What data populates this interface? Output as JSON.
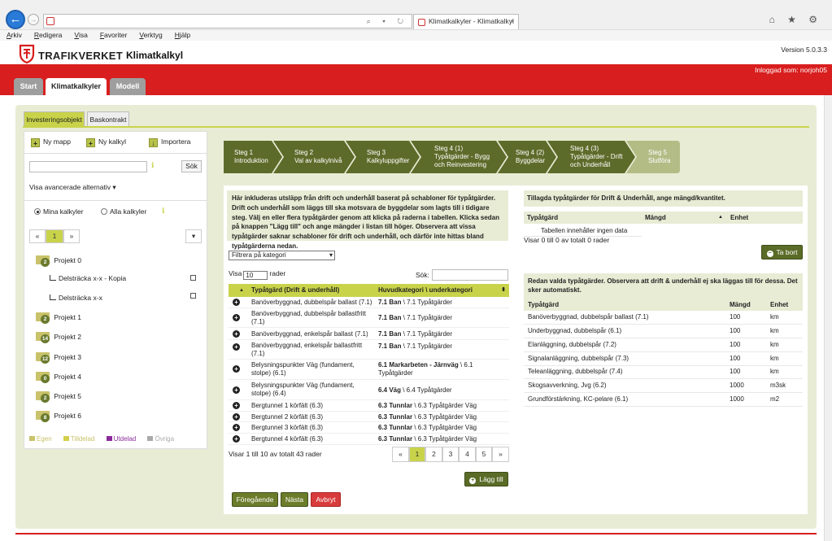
{
  "browser": {
    "tab_title": "Klimatkalkyler - Klimatkalkyl",
    "back_icon": "←",
    "forward_icon": "→",
    "address_controls": "⌕ ▾ ↻",
    "tab_close": "×",
    "icons": "⌂ ★ ⚙",
    "menu": [
      "Arkiv",
      "Redigera",
      "Visa",
      "Favoriter",
      "Verktyg",
      "Hjälp"
    ]
  },
  "header": {
    "brand": "TRAFIKVERKET",
    "app_name": "Klimatkalkyl",
    "version": "Version 5.0.3.3",
    "logged_in": "Inloggad som: norjoh05"
  },
  "nav": {
    "start": "Start",
    "klimatkalkyler": "Klimatkalkyler",
    "modell": "Modell"
  },
  "subtabs": {
    "investering": "Investeringsobjekt",
    "baskontrakt": "Baskontrakt"
  },
  "left": {
    "plus_icon": "+",
    "import_icon": "↓",
    "info_icon": "ℹ",
    "chevron_icon": "▾",
    "new_folder": "Ny mapp",
    "new_calc": "Ny kalkyl",
    "import": "Importera",
    "search_button": "Sök",
    "advanced": "Visa avancerade alternativ",
    "radio_mine": "Mina kalkyler",
    "radio_all": "Alla kalkyler",
    "pager": {
      "prev": "«",
      "page": "1",
      "next": "»",
      "dropdown": "▾"
    },
    "projects": [
      {
        "name": "Projekt 0",
        "count": "2"
      },
      {
        "name": "Projekt 1",
        "count": "2"
      },
      {
        "name": "Projekt 2",
        "count": "14"
      },
      {
        "name": "Projekt 3",
        "count": "12"
      },
      {
        "name": "Projekt 4",
        "count": "0"
      },
      {
        "name": "Projekt 5",
        "count": "2"
      },
      {
        "name": "Projekt 6",
        "count": "8"
      }
    ],
    "calcs": [
      "Delsträcka x-x - Kopia",
      "Delsträcka x-x"
    ],
    "legend": [
      {
        "label": "Egen",
        "color": "#c9c26a"
      },
      {
        "label": "Tilldelad",
        "color": "#d4cf4a"
      },
      {
        "label": "Utdelad",
        "color": "#8a2a9a"
      },
      {
        "label": "Övriga",
        "color": "#aaaaaa"
      }
    ]
  },
  "steps": [
    {
      "l1": "Steg 1",
      "l2": "Introduktion",
      "l3": "",
      "color": "#5d6b2a"
    },
    {
      "l1": "Steg 2",
      "l2": "Val av kalkylnivå",
      "l3": "",
      "color": "#5d6b2a"
    },
    {
      "l1": "Steg 3",
      "l2": "Kalkyluppgifter",
      "l3": "",
      "color": "#5d6b2a"
    },
    {
      "l1": "Steg 4 (1)",
      "l2": "Typåtgärder - Bygg",
      "l3": "och Reinvestering",
      "color": "#5d6b2a"
    },
    {
      "l1": "Steg 4 (2)",
      "l2": "Byggdelar",
      "l3": "",
      "color": "#5d6b2a"
    },
    {
      "l1": "Steg 4 (3)",
      "l2": "Typåtgärder - Drift",
      "l3": "och Underhåll",
      "color": "#5d6b2a"
    },
    {
      "l1": "Steg 5",
      "l2": "Slutföra",
      "l3": "",
      "color": "#b4bc86"
    }
  ],
  "intro": "Här inkluderas utsläpp från drift och underhåll baserat på schabloner för typåtgärder. Drift och underhåll som läggs till ska motsvara de byggdelar som lagts till i tidigare steg. Välj en eller flera typåtgärder genom att klicka på raderna i tabellen. Klicka sedan på knappen \"Lägg till\" och ange mängder i listan till höger. Observera att vissa typåtgärder saknar schabloner för drift och underhåll, och därför inte hittas bland typåtgärderna nedan.",
  "filter": {
    "value": "Filtrera på kategori"
  },
  "show": {
    "prefix": "Visa",
    "value": "10",
    "suffix": "rader",
    "search": "Sök:"
  },
  "table": {
    "headers": [
      "Typåtgärd (Drift & underhåll)",
      "Huvudkategori \\ underkategori"
    ],
    "sort_asc": "▲",
    "sort_both": "⬍",
    "add_icon": "+",
    "rows": [
      {
        "name": "Banöverbyggnad, dubbelspår ballast (7.1)",
        "cat": "7.1 Ban",
        "sub": " \\ 7.1 Typåtgärder"
      },
      {
        "name": "Banöverbyggnad, dubbelspår ballastfritt (7.1)",
        "cat": "7.1 Ban",
        "sub": " \\ 7.1 Typåtgärder"
      },
      {
        "name": "Banöverbyggnad, enkelspår ballast (7.1)",
        "cat": "7.1 Ban",
        "sub": " \\ 7.1 Typåtgärder"
      },
      {
        "name": "Banöverbyggnad, enkelspår ballastfritt (7.1)",
        "cat": "7.1 Ban",
        "sub": " \\ 7.1 Typåtgärder"
      },
      {
        "name": "Belysningspunkter Väg (fundament, stolpe) (6.1)",
        "cat": "6.1 Markarbeten - Järnväg",
        "sub": " \\ 6.1 Typåtgärder"
      },
      {
        "name": "Belysningspunkter Väg (fundament, stolpe) (6.4)",
        "cat": "6.4 Väg",
        "sub": " \\ 6.4 Typåtgärder"
      },
      {
        "name": "Bergtunnel 1 körfält (6.3)",
        "cat": "6.3 Tunnlar",
        "sub": " \\ 6.3 Typåtgärder Väg"
      },
      {
        "name": "Bergtunnel 2 körfält (6.3)",
        "cat": "6.3 Tunnlar",
        "sub": " \\ 6.3 Typåtgärder Väg"
      },
      {
        "name": "Bergtunnel 3 körfält (6.3)",
        "cat": "6.3 Tunnlar",
        "sub": " \\ 6.3 Typåtgärder Väg"
      },
      {
        "name": "Bergtunnel 4 körfält (6.3)",
        "cat": "6.3 Tunnlar",
        "sub": " \\ 6.3 Typåtgärder Väg"
      }
    ],
    "info": "Visar 1 till 10 av totalt 43 rader",
    "pager": [
      "«",
      "1",
      "2",
      "3",
      "4",
      "5",
      "»"
    ]
  },
  "buttons": {
    "add": "Lägg till",
    "remove": "Ta bort",
    "prev": "Föregående",
    "next": "Nästa",
    "cancel": "Avbryt",
    "add_icon": "+",
    "remove_icon": "−"
  },
  "added": {
    "title": "Tillagda typåtgärder för Drift & Underhåll, ange mängd/kvantitet.",
    "headers": [
      "Typåtgärd",
      "Mängd",
      "Enhet"
    ],
    "sort_asc": "▲",
    "empty": "Tabellen innehåller ingen data",
    "info": "Visar 0 till 0 av totalt 0 rader"
  },
  "selected": {
    "title": "Redan valda typåtgärder. Observera att drift & underhåll ej ska läggas till för dessa. Det sker automatiskt.",
    "headers": [
      "Typåtgärd",
      "Mängd",
      "Enhet"
    ],
    "rows": [
      [
        "Banöverbyggnad, dubbelspår ballast (7.1)",
        "100",
        "km"
      ],
      [
        "Underbyggnad, dubbelspår (6.1)",
        "100",
        "km"
      ],
      [
        "Elanläggning, dubbelspår (7.2)",
        "100",
        "km"
      ],
      [
        "Signalanläggning, dubbelspår (7.3)",
        "100",
        "km"
      ],
      [
        "Teleanläggning, dubbelspår (7.4)",
        "100",
        "km"
      ],
      [
        "Skogsavverkning, Jvg (6.2)",
        "1000",
        "m3sk"
      ],
      [
        "Grundförstärkning, KC-pelare (6.1)",
        "1000",
        "m2"
      ]
    ]
  }
}
